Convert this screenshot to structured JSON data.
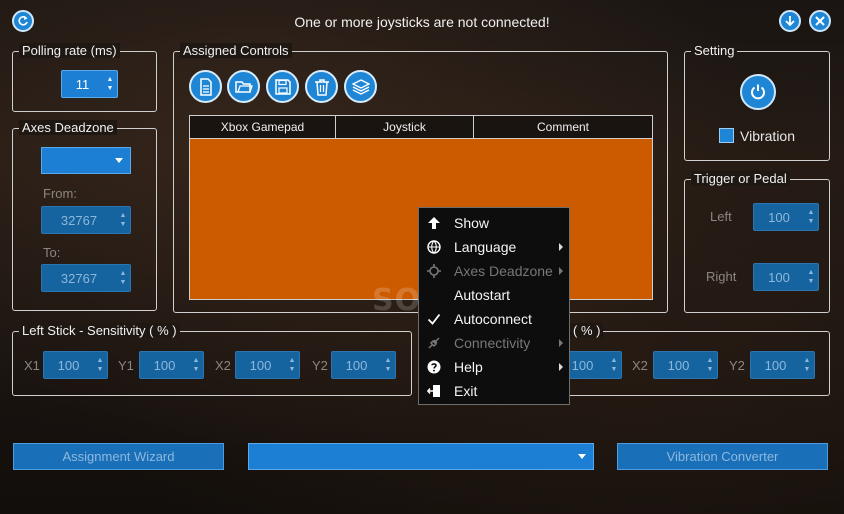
{
  "window": {
    "title": "One or more joysticks are not connected!",
    "icons": [
      "refresh-icon",
      "download-icon",
      "close-icon"
    ]
  },
  "polling": {
    "label": "Polling rate (ms)",
    "value": "11"
  },
  "deadzone": {
    "label": "Axes Deadzone",
    "dropdown_value": "",
    "from_label": "From:",
    "from_value": "32767",
    "to_label": "To:",
    "to_value": "32767"
  },
  "assigned": {
    "label": "Assigned Controls",
    "tools": [
      "new-document-icon",
      "open-folder-icon",
      "save-icon",
      "trash-icon",
      "layers-icon"
    ],
    "columns": [
      "Xbox Gamepad",
      "Joystick",
      "Comment"
    ],
    "row_color": "#cc5b00"
  },
  "setting": {
    "label": "Setting",
    "vibration_label": "Vibration",
    "vibration_checked": false
  },
  "trigger": {
    "label": "Trigger or Pedal",
    "left_label": "Left",
    "left_value": "100",
    "right_label": "Right",
    "right_value": "100"
  },
  "left_stick": {
    "label": "Left Stick - Sensitivity ( % )",
    "fields": [
      {
        "label": "X1",
        "value": "100"
      },
      {
        "label": "Y1",
        "value": "100"
      },
      {
        "label": "X2",
        "value": "100"
      },
      {
        "label": "Y2",
        "value": "100"
      }
    ]
  },
  "right_stick": {
    "label_tail": "( % )",
    "fields": [
      {
        "label": "",
        "value": "100"
      },
      {
        "label": "X2",
        "value": "100"
      },
      {
        "label": "Y2",
        "value": "100"
      }
    ]
  },
  "bottom": {
    "wizard_label": "Assignment Wizard",
    "dropdown_value": "",
    "converter_label": "Vibration Converter"
  },
  "context_menu": {
    "items": [
      {
        "label": "Show",
        "icon": "arrow-up-icon",
        "enabled": true,
        "submenu": false
      },
      {
        "label": "Language",
        "icon": "globe-icon",
        "enabled": true,
        "submenu": true
      },
      {
        "label": "Axes Deadzone",
        "icon": "deadzone-icon",
        "enabled": false,
        "submenu": true
      },
      {
        "label": "Autostart",
        "icon": "",
        "enabled": true,
        "submenu": false
      },
      {
        "label": "Autoconnect",
        "icon": "check-icon",
        "enabled": true,
        "submenu": false
      },
      {
        "label": "Connectivity",
        "icon": "plug-icon",
        "enabled": false,
        "submenu": true
      },
      {
        "label": "Help",
        "icon": "question-icon",
        "enabled": true,
        "submenu": true
      },
      {
        "label": "Exit",
        "icon": "exit-door-icon",
        "enabled": true,
        "submenu": false
      }
    ]
  },
  "colors": {
    "accent": "#1f86d6",
    "table_fill": "#cc5b00",
    "menu_bg": "#0d0d0d"
  },
  "watermark": "SOFTPEDIA"
}
